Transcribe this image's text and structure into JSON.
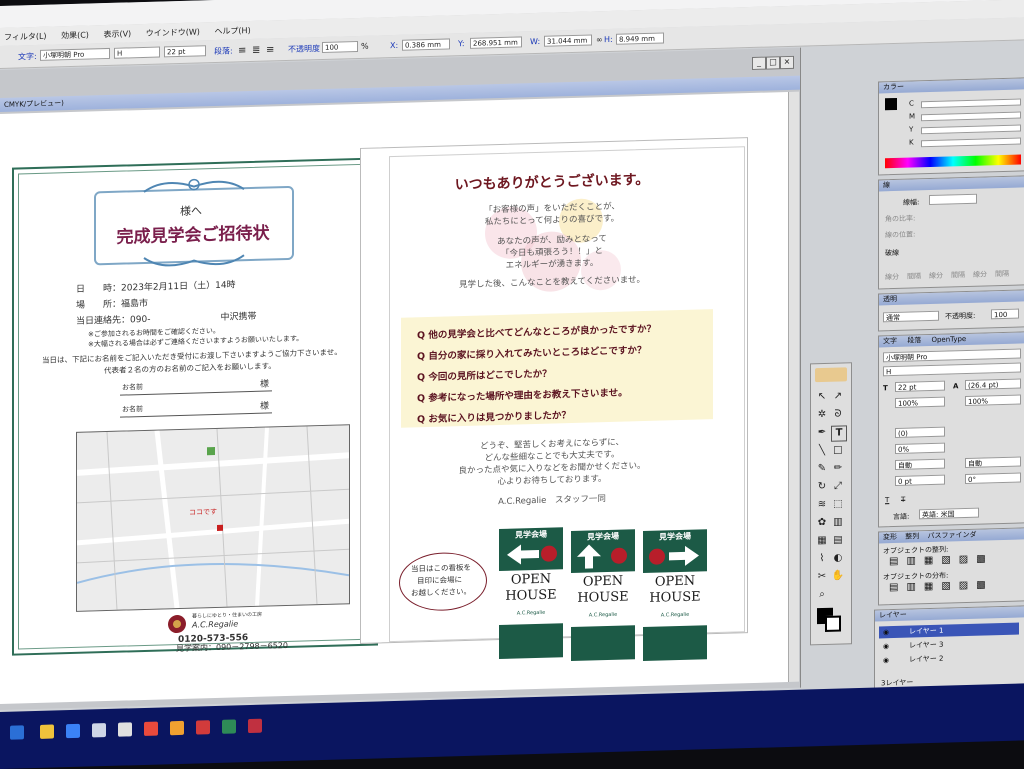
{
  "menu": [
    "フィルタ(L)",
    "効果(C)",
    "表示(V)",
    "ウインドウ(W)",
    "ヘルプ(H)"
  ],
  "control_bar": {
    "text_label": "文字:",
    "font": "小塚明朝 Pro",
    "style": "H",
    "size": "22 pt",
    "paragraph_label": "段落:",
    "opacity_label": "不透明度",
    "opacity": "100",
    "opacity_unit": "%",
    "x_label": "X:",
    "x": "0.386 mm",
    "y_label": "Y:",
    "y": "268.951 mm",
    "w_label": "W:",
    "w": "31.044 mm",
    "h_label": "H:",
    "h": "8.949 mm"
  },
  "document": {
    "title": "CMYK/プレビュー)"
  },
  "invitation": {
    "to": "様へ",
    "title": "完成見学会ご招待状",
    "date_label": "日　　時：",
    "date": "2023年2月11日（土）14時",
    "place_label": "場　　所：",
    "place": "福島市",
    "contact_label": "当日連絡先：",
    "contact": "090-",
    "contact_name": "中沢携帯",
    "note1": "※ご参加されるお時間をご確認ください。",
    "note2": "※大幅される場合は必ずご連絡くださいますようお願いいたします。",
    "request1": "当日は、下記にお名前をご記入いただき受付にお渡し下さいますようご協力下さいませ。",
    "request2": "代表者２名の方のお名前のご記入をお願いします。",
    "name_label": "お名前",
    "name_suffix": "様",
    "map_marker": "ココです",
    "company_line": "暮らしにゆとり・住まいの工房",
    "company": "A.C.Regalie",
    "phone_free": "0120-573-556",
    "phone_label": "見学案内：",
    "phone": "090－2798－6520"
  },
  "thanks": {
    "title": "いつもありがとうございます。",
    "lines": [
      "「お客様の声」をいただくことが、",
      "私たちにとって何よりの喜びです。",
      "あなたの声が、励みとなって",
      "「今日も頑張ろう！！」と",
      "エネルギーが湧きます。",
      "見学した後、こんなことを教えてくださいませ。"
    ],
    "questions": [
      "Q 他の見学会と比べてどんなところが良かったですか？",
      "Q 自分の家に採り入れてみたいところはどこですか？",
      "Q 今回の見所はどこでしたか？",
      "Q 参考になった場所や理由をお教え下さいませ。",
      "Q お気に入りは見つかりましたか？"
    ],
    "closing": [
      "どうぞ、堅苦しくお考えにならずに、",
      "どんな些細なことでも大丈夫です。",
      "良かった点や気に入りなどをお聞かせください。",
      "心よりお待ちしております。"
    ],
    "signature": "A.C.Regalie　スタッフ一同",
    "oval_note": [
      "当日はこの看板を",
      "目印に会場に",
      "お越しください。"
    ],
    "sign_label": "見学会場",
    "open": "OPEN",
    "house": "HOUSE",
    "sign_company": "A.C.Regalie"
  },
  "panels": {
    "color": {
      "title": "カラー",
      "channels": [
        "C",
        "M",
        "Y",
        "K"
      ]
    },
    "stroke": {
      "title": "線",
      "weight_label": "線幅:",
      "miter_label": "角の比率:",
      "align_label": "線の位置:",
      "dashed": "破線",
      "dash_labels": [
        "線分",
        "間隔",
        "線分",
        "間隔",
        "線分",
        "間隔"
      ]
    },
    "transparency": {
      "title": "透明",
      "mode": "通常",
      "opacity_label": "不透明度:",
      "opacity": "100"
    },
    "character": {
      "tabs": [
        "文字",
        "段落",
        "OpenType"
      ],
      "font": "小塚明朝 Pro",
      "style": "H",
      "size": "22 pt",
      "leading": "(26.4 pt)",
      "hscale": "100%",
      "vscale": "100%",
      "tracking": "(0)",
      "kerning": "0%",
      "auto1": "自動",
      "auto2": "自動",
      "baseline": "0 pt",
      "rotate": "0°",
      "language_label": "言語:",
      "language": "英語: 米国"
    },
    "align": {
      "tabs": [
        "変形",
        "整列",
        "パスファインダ"
      ],
      "align_objects": "オブジェクトの整列:",
      "distribute": "オブジェクトの分布:"
    },
    "layers": {
      "title": "レイヤー",
      "items": [
        "レイヤー 1",
        "レイヤー 3",
        "レイヤー 2"
      ],
      "footer": "3レイヤー"
    }
  },
  "colors": {
    "accent": "#1c5a46",
    "title": "#7a1f4c"
  }
}
